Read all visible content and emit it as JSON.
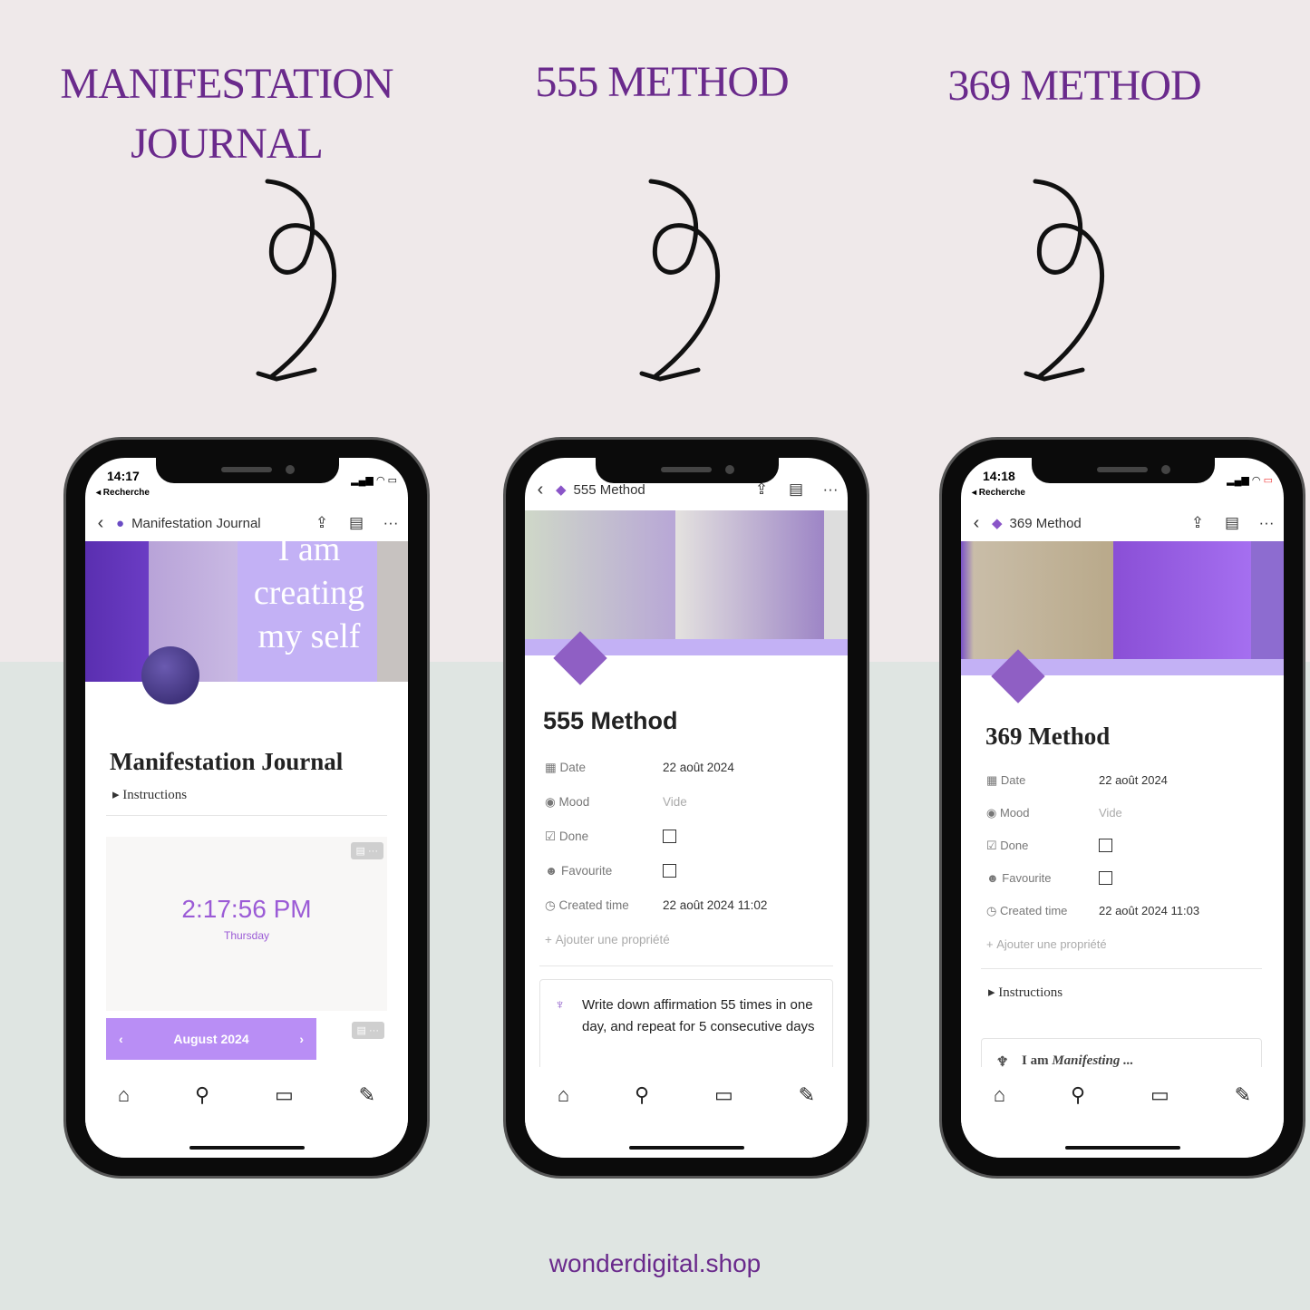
{
  "titles": {
    "journal": "MANIFESTATION JOURNAL",
    "m555": "555 METHOD",
    "m369": "369 METHOD"
  },
  "footer": "wonderdigital.shop",
  "colors": {
    "brand": "#6a2a8c",
    "accent": "#a98af2",
    "banner": "#c3b1f5"
  },
  "common": {
    "back_app": "◂ Recherche",
    "empty": "Vide",
    "add_property": "Ajouter une propriété",
    "instructions": "Instructions",
    "props": {
      "date": "Date",
      "mood": "Mood",
      "done": "Done",
      "favourite": "Favourite",
      "created": "Created time"
    }
  },
  "phone1": {
    "time": "14:17",
    "nav_title": "Manifestation Journal",
    "cover_text": "I am creating my self",
    "page_title": "Manifestation Journal",
    "clock": "2:17:56 PM",
    "day": "Thursday",
    "calendar": "August 2024"
  },
  "phone2": {
    "nav_title": "555 Method",
    "page_title": "555 Method",
    "date": "22 août 2024",
    "created": "22 août 2024 11:02",
    "callout": "Write down affirmation 55 times in one day, and repeat for 5 consecutive days"
  },
  "phone3": {
    "time": "14:18",
    "nav_title": "369 Method",
    "page_title": "369 Method",
    "date": "22 août 2024",
    "created": "22 août 2024 11:03",
    "callout_a": "I am ",
    "callout_b": "Manifesting ..."
  }
}
